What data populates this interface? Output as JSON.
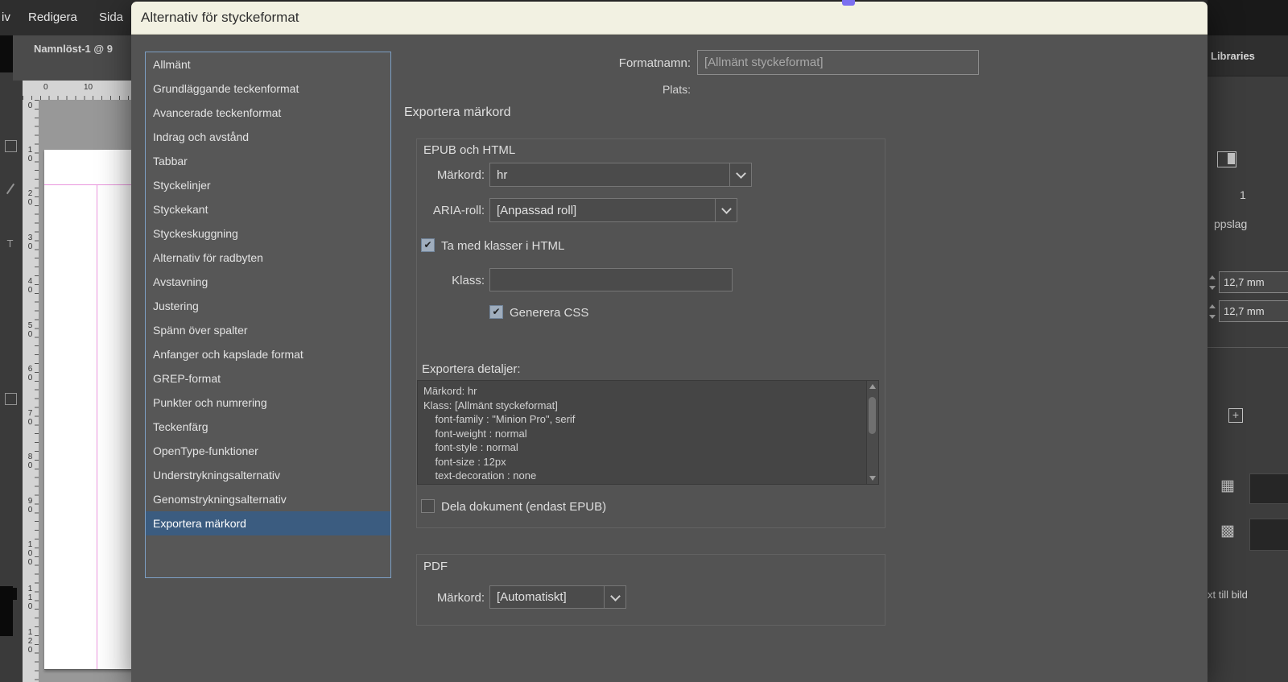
{
  "colors": {
    "selection_blue": "#3b5c80",
    "titlebar_cream": "#f2f1e2",
    "dialog_gray": "#535353",
    "margin_guide_pink": "#ea96dd"
  },
  "icons": {
    "check": "✔",
    "type_tool": "T",
    "plus_box": "+",
    "table": "▦",
    "grid": "▩"
  },
  "app": {
    "menu_items": [
      "iv",
      "Redigera",
      "Sida"
    ],
    "document_tab": "Namnlöst-1 @ 9",
    "rulers": {
      "horizontal_numbers": [
        "0",
        "10"
      ],
      "vertical_numbers": [
        "0",
        "10",
        "20",
        "30",
        "40",
        "50",
        "60",
        "70",
        "80",
        "90",
        "100",
        "110",
        "120"
      ]
    }
  },
  "right_panel": {
    "tab_label": "Libraries",
    "pages_count": "1",
    "uppslag_label": "ppslag",
    "mm_values": [
      "12,7 mm",
      "12,7 mm"
    ],
    "text_to_image_label": "xt till bild"
  },
  "dialog": {
    "title": "Alternativ för styckeformat",
    "sidebar": {
      "items": [
        "Allmänt",
        "Grundläggande teckenformat",
        "Avancerade teckenformat",
        "Indrag och avstånd",
        "Tabbar",
        "Styckelinjer",
        "Styckekant",
        "Styckeskuggning",
        "Alternativ för radbyten",
        "Avstavning",
        "Justering",
        "Spänn över spalter",
        "Anfanger och kapslade format",
        "GREP-format",
        "Punkter och numrering",
        "Teckenfärg",
        "OpenType-funktioner",
        "Understrykningsalternativ",
        "Genomstrykningsalternativ",
        "Exportera märkord"
      ],
      "selected": "Exportera märkord"
    },
    "format_name": {
      "label": "Formatnamn:",
      "value": "[Allmänt styckeformat]"
    },
    "plats_label": "Plats:",
    "section_title": "Exportera märkord",
    "epub_group": {
      "title": "EPUB och HTML",
      "markord": {
        "label": "Märkord:",
        "value": "hr"
      },
      "aria": {
        "label": "ARIA-roll:",
        "value": "[Anpassad roll]"
      },
      "include_classes": {
        "label": "Ta med klasser i HTML",
        "checked": true
      },
      "klass": {
        "label": "Klass:",
        "value": ""
      },
      "generate_css": {
        "label": "Generera CSS",
        "checked": true
      },
      "export_details": {
        "label": "Exportera detaljer:",
        "lines": [
          "Märkord: hr",
          "Klass: [Allmänt styckeformat]",
          "    font-family : \"Minion Pro\", serif",
          "    font-weight : normal",
          "    font-style : normal",
          "    font-size : 12px",
          "    text-decoration : none"
        ]
      },
      "split_document": {
        "label": "Dela dokument (endast EPUB)",
        "checked": false
      }
    },
    "pdf_group": {
      "title": "PDF",
      "markord": {
        "label": "Märkord:",
        "value": "[Automatiskt]"
      }
    }
  }
}
